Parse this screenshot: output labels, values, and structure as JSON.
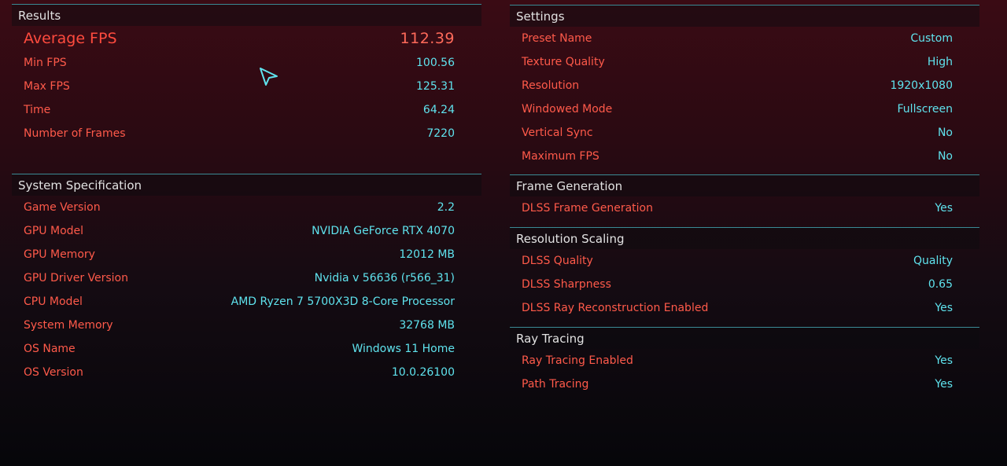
{
  "results": {
    "title": "Results",
    "average": {
      "label": "Average FPS",
      "value": "112.39"
    },
    "rows": [
      {
        "label": "Min FPS",
        "value": "100.56"
      },
      {
        "label": "Max FPS",
        "value": "125.31"
      },
      {
        "label": "Time",
        "value": "64.24"
      },
      {
        "label": "Number of Frames",
        "value": "7220"
      }
    ]
  },
  "system": {
    "title": "System Specification",
    "rows": [
      {
        "label": "Game Version",
        "value": "2.2"
      },
      {
        "label": "GPU Model",
        "value": "NVIDIA GeForce RTX 4070"
      },
      {
        "label": "GPU Memory",
        "value": "12012 MB"
      },
      {
        "label": "GPU Driver Version",
        "value": "Nvidia v 56636 (r566_31)"
      },
      {
        "label": "CPU Model",
        "value": "AMD Ryzen 7 5700X3D 8-Core Processor"
      },
      {
        "label": "System Memory",
        "value": "32768 MB"
      },
      {
        "label": "OS Name",
        "value": "Windows 11 Home"
      },
      {
        "label": "OS Version",
        "value": "10.0.26100"
      }
    ]
  },
  "settings": {
    "title": "Settings",
    "rows": [
      {
        "label": "Preset Name",
        "value": "Custom"
      },
      {
        "label": "Texture Quality",
        "value": "High"
      },
      {
        "label": "Resolution",
        "value": "1920x1080"
      },
      {
        "label": "Windowed Mode",
        "value": "Fullscreen"
      },
      {
        "label": "Vertical Sync",
        "value": "No"
      },
      {
        "label": "Maximum FPS",
        "value": "No"
      }
    ]
  },
  "frame_generation": {
    "title": "Frame Generation",
    "rows": [
      {
        "label": "DLSS Frame Generation",
        "value": "Yes"
      }
    ]
  },
  "resolution_scaling": {
    "title": "Resolution Scaling",
    "rows": [
      {
        "label": "DLSS Quality",
        "value": "Quality"
      },
      {
        "label": "DLSS Sharpness",
        "value": "0.65"
      },
      {
        "label": "DLSS Ray Reconstruction Enabled",
        "value": "Yes"
      }
    ]
  },
  "ray_tracing": {
    "title": "Ray Tracing",
    "rows": [
      {
        "label": "Ray Tracing Enabled",
        "value": "Yes"
      },
      {
        "label": "Path Tracing",
        "value": "Yes"
      }
    ]
  },
  "icons": {
    "cursor": "pointer-arrow-icon"
  },
  "colors": {
    "label": "#ff5a4a",
    "value": "#5fe3ee",
    "divider": "#3a8a94"
  }
}
